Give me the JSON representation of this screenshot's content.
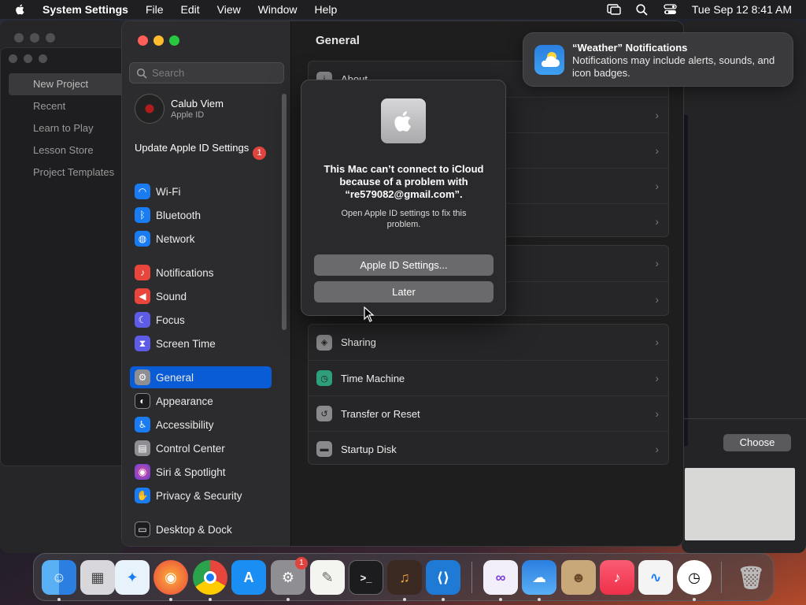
{
  "menubar": {
    "app_name": "System Settings",
    "items": [
      "File",
      "Edit",
      "View",
      "Window",
      "Help"
    ],
    "clock": "Tue Sep 12  8:41 AM"
  },
  "background_window": {
    "list": [
      "New Project",
      "Recent",
      "Learn to Play",
      "Lesson Store",
      "Project Templates"
    ],
    "choose_label": "Choose"
  },
  "sidebar": {
    "search_placeholder": "Search",
    "account": {
      "name": "Calub Viem",
      "subtitle": "Apple ID"
    },
    "update": {
      "label": "Update Apple ID Settings",
      "badge": "1"
    },
    "items": [
      {
        "label": "Wi-Fi",
        "icon": "wifi-icon",
        "color": "#1a7cf2"
      },
      {
        "label": "Bluetooth",
        "icon": "bluetooth-icon",
        "color": "#1a7cf2"
      },
      {
        "label": "Network",
        "icon": "globe-icon",
        "color": "#1a7cf2"
      },
      {
        "label": "Notifications",
        "icon": "bell-icon",
        "color": "#e8453c"
      },
      {
        "label": "Sound",
        "icon": "speaker-icon",
        "color": "#e8453c"
      },
      {
        "label": "Focus",
        "icon": "moon-icon",
        "color": "#5e5ce6"
      },
      {
        "label": "Screen Time",
        "icon": "hourglass-icon",
        "color": "#5e5ce6"
      },
      {
        "label": "General",
        "icon": "gear-icon",
        "color": "#8e8e93"
      },
      {
        "label": "Appearance",
        "icon": "appearance-icon",
        "color": "#1c1c1e"
      },
      {
        "label": "Accessibility",
        "icon": "accessibility-icon",
        "color": "#1a7cf2"
      },
      {
        "label": "Control Center",
        "icon": "control-center-icon",
        "color": "#8e8e93"
      },
      {
        "label": "Siri & Spotlight",
        "icon": "siri-icon",
        "color": "#b34fd6"
      },
      {
        "label": "Privacy & Security",
        "icon": "hand-icon",
        "color": "#1a7cf2"
      },
      {
        "label": "Desktop & Dock",
        "icon": "dock-icon",
        "color": "#1c1c1e"
      }
    ]
  },
  "main": {
    "title": "General",
    "group1_first": "About",
    "group3": [
      "Sharing",
      "Time Machine",
      "Transfer or Reset",
      "Startup Disk"
    ]
  },
  "dialog": {
    "title": "This Mac can’t connect to iCloud because of a problem with “re579082@gmail.com”.",
    "message": "Open Apple ID settings to fix this problem.",
    "primary_button": "Apple ID Settings...",
    "secondary_button": "Later"
  },
  "notification": {
    "title": "“Weather” Notifications",
    "body": "Notifications may include alerts, sounds, and icon badges."
  },
  "dock": {
    "settings_badge": "1",
    "apps": [
      "Finder",
      "Launchpad",
      "Safari",
      "Firefox",
      "Chrome",
      "App Store",
      "System Settings",
      "TextEdit",
      "Terminal",
      "GarageBand",
      "VS Code",
      "Visual Studio",
      "Weather",
      "Contacts",
      "Music",
      "Freeform",
      "Clock",
      "Trash"
    ]
  }
}
